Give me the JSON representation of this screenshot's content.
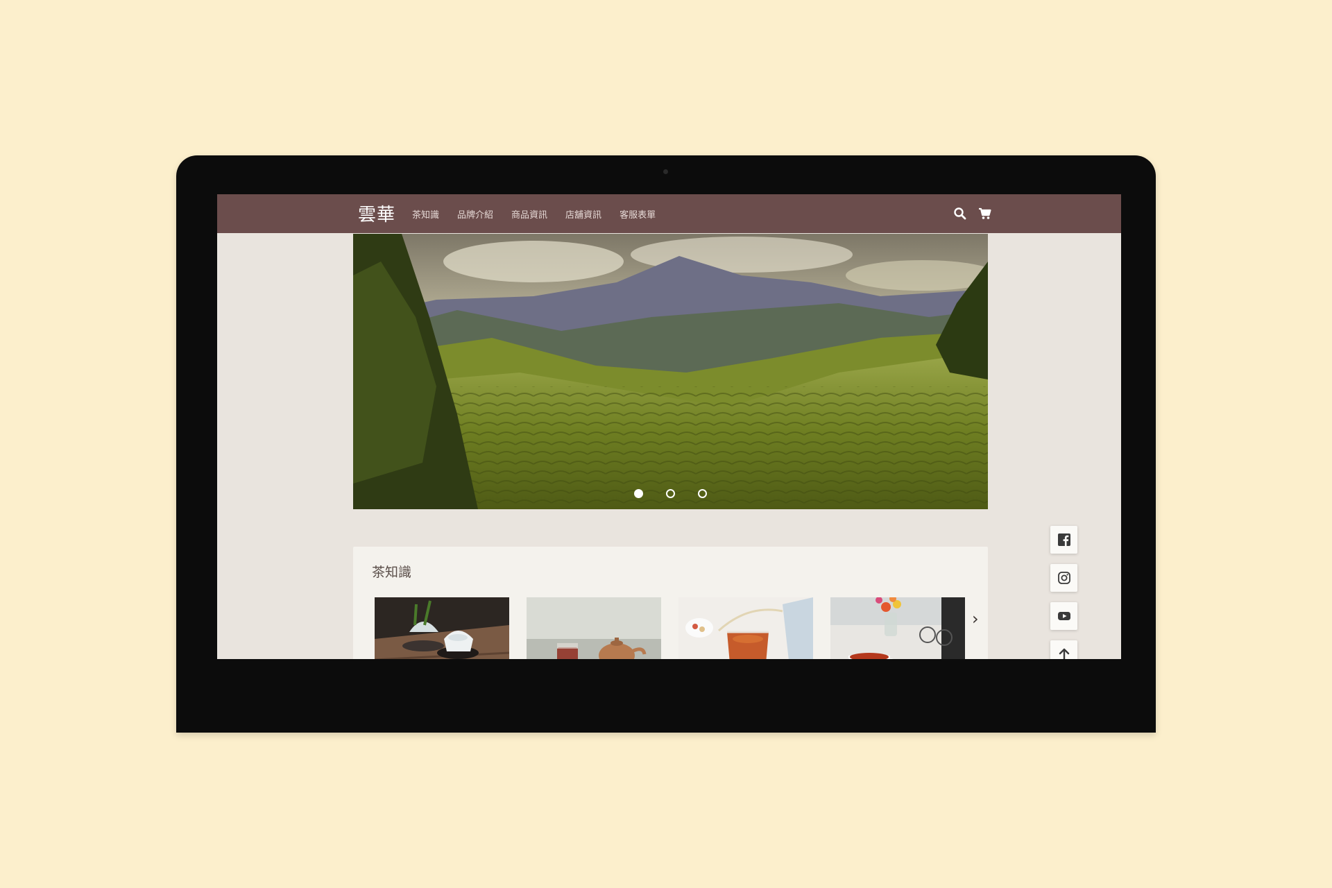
{
  "site": {
    "brand": "雲華",
    "nav": [
      "茶知識",
      "品牌介紹",
      "商品資訊",
      "店舖資訊",
      "客服表單"
    ],
    "icons": [
      "search-icon",
      "cart-icon"
    ]
  },
  "hero": {
    "slides": 3,
    "active_slide": 1
  },
  "knowledge": {
    "title": "茶知識",
    "next_icon": "›"
  },
  "social": [
    "facebook-icon",
    "instagram-icon",
    "youtube-icon",
    "arrow-up-icon"
  ],
  "colors": {
    "background": "#fcefcc",
    "navbar": "#6b4d4c",
    "screen_bg": "#e9e4de",
    "card_bg": "#f4f2ed",
    "bezel": "#0c0c0c"
  }
}
